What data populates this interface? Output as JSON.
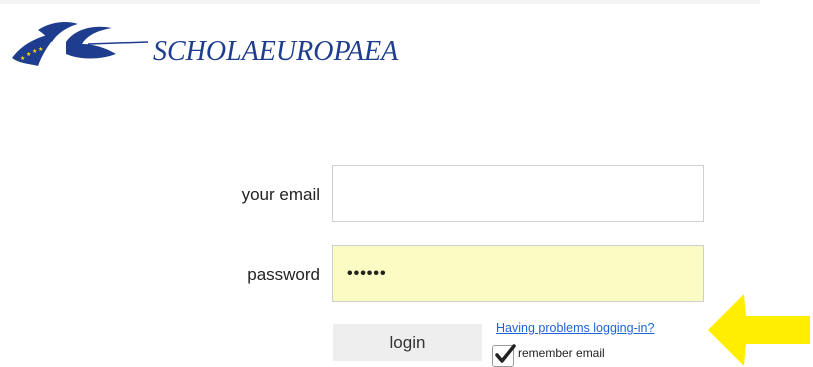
{
  "header": {
    "logo_text": "SCHOLAEUROPAEA",
    "logo_icon": "schola-europaea-logo-icon"
  },
  "login_form": {
    "email_label": "your email",
    "email_value": "",
    "email_placeholder": "",
    "password_label": "password",
    "password_value": "••••••",
    "password_field_color": "#fbfcc4",
    "login_label": "login",
    "help_link_label": "Having problems logging-in?",
    "remember_label": "remember email",
    "remember_checked": true
  },
  "annotation": {
    "arrow_icon": "yellow-arrow-icon",
    "arrow_color": "#ffee00"
  },
  "colors": {
    "brand_blue": "#1f3d8f",
    "link_blue": "#1a66d6",
    "button_bg": "#eeeeee"
  }
}
